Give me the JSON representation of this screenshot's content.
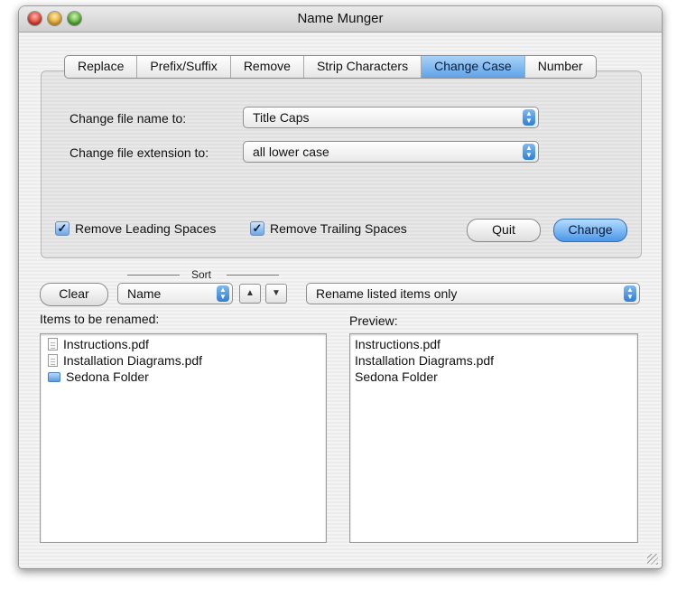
{
  "window": {
    "title": "Name Munger"
  },
  "tabs": [
    {
      "label": "Replace",
      "active": false
    },
    {
      "label": "Prefix/Suffix",
      "active": false
    },
    {
      "label": "Remove",
      "active": false
    },
    {
      "label": "Strip Characters",
      "active": false
    },
    {
      "label": "Change Case",
      "active": true
    },
    {
      "label": "Number",
      "active": false
    }
  ],
  "change_case": {
    "name_label": "Change file name to:",
    "name_value": "Title Caps",
    "ext_label": "Change file extension to:",
    "ext_value": "all lower case",
    "remove_leading": {
      "label": "Remove Leading Spaces",
      "checked": true
    },
    "remove_trailing": {
      "label": "Remove Trailing Spaces",
      "checked": true
    },
    "quit_label": "Quit",
    "change_label": "Change"
  },
  "sort": {
    "header": "Sort",
    "field": "Name",
    "clear_label": "Clear",
    "up_glyph": "▲",
    "down_glyph": "▼",
    "mode": "Rename listed items only"
  },
  "items": {
    "label": "Items to be renamed:",
    "list": [
      {
        "name": "Instructions.pdf",
        "icon": "document-icon"
      },
      {
        "name": "Installation Diagrams.pdf",
        "icon": "document-icon"
      },
      {
        "name": "Sedona Folder",
        "icon": "folder-icon"
      }
    ]
  },
  "preview": {
    "label": "Preview:",
    "list": [
      "Instructions.pdf",
      "Installation Diagrams.pdf",
      "Sedona Folder"
    ]
  },
  "colors": {
    "accent": "#5ea3e8",
    "window_bg": "#ececec"
  }
}
